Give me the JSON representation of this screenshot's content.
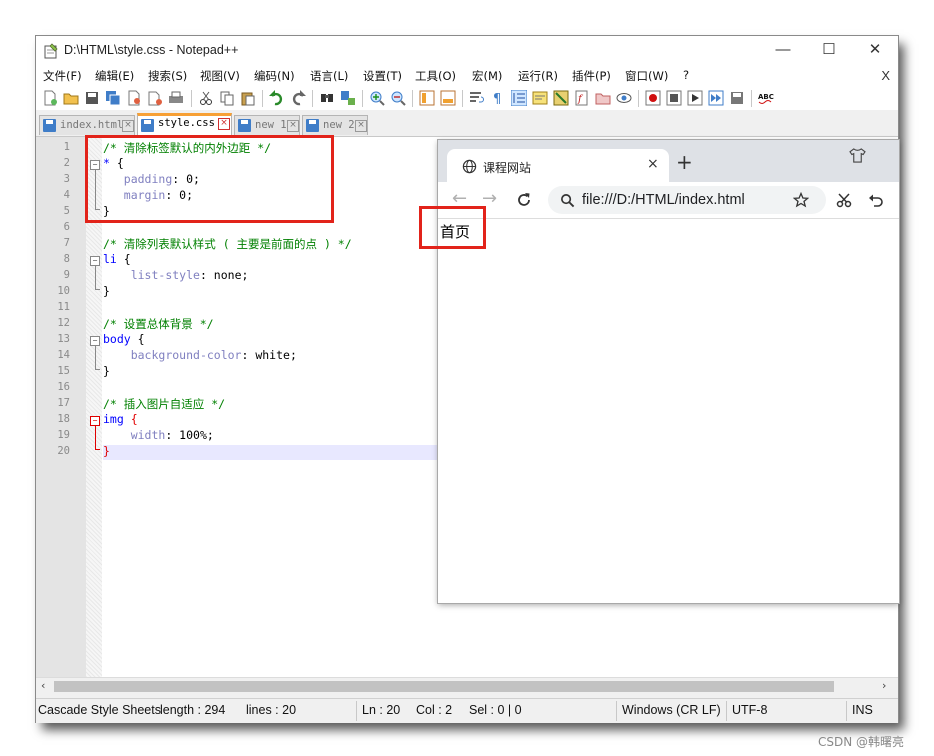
{
  "window": {
    "title": "D:\\HTML\\style.css - Notepad++",
    "minimize": "—",
    "maximize": "☐",
    "close": "✕"
  },
  "menu": {
    "items": [
      "文件(F)",
      "编辑(E)",
      "搜索(S)",
      "视图(V)",
      "编码(N)",
      "语言(L)",
      "设置(T)",
      "工具(O)",
      "宏(M)",
      "运行(R)",
      "插件(P)",
      "窗口(W)",
      "?"
    ],
    "close": "X"
  },
  "tabs": [
    {
      "label": "index.html",
      "active": false
    },
    {
      "label": "style.css",
      "active": true
    },
    {
      "label": "new 1",
      "active": false
    },
    {
      "label": "new 2",
      "active": false
    }
  ],
  "editor": {
    "line_numbers": [
      "1",
      "2",
      "3",
      "4",
      "5",
      "6",
      "7",
      "8",
      "9",
      "10",
      "11",
      "12",
      "13",
      "14",
      "15",
      "16",
      "17",
      "18",
      "19",
      "20"
    ],
    "lines": {
      "l1": "/* 清除标签默认的内外边距 */",
      "l2_sel": "* ",
      "l2_brace": "{",
      "l3_prop": "padding",
      "l3_val": ": 0;",
      "l4_prop": "margin",
      "l4_val": ": 0;",
      "l5": "}",
      "l7": "/* 清除列表默认样式 ( 主要是前面的点 ) */",
      "l8_sel": "li ",
      "l8_brace": "{",
      "l9_prop": "list-style",
      "l9_val": ": none;",
      "l10": "}",
      "l12": "/* 设置总体背景 */",
      "l13_sel": "body ",
      "l13_brace": "{",
      "l14_prop": "background-color",
      "l14_val": ": white;",
      "l15": "}",
      "l17": "/* 插入图片自适应 */",
      "l18_sel": "img ",
      "l18_brace": "{",
      "l19_prop": "width",
      "l19_val": ": 100%;",
      "l20": "}"
    }
  },
  "status": {
    "language": "Cascade Style Sheets",
    "length": "length : 294",
    "lines": "lines : 20",
    "ln": "Ln : 20",
    "col": "Col : 2",
    "sel": "Sel : 0 | 0",
    "eol": "Windows (CR LF)",
    "encoding": "UTF-8",
    "mode": "INS"
  },
  "browser": {
    "tab_title": "课程网站",
    "tab_close": "×",
    "new_tab": "+",
    "url": "file:///D:/HTML/index.html",
    "page_text": "首页",
    "back": "←",
    "forward": "→"
  },
  "watermark": "CSDN @韩曙亮",
  "colors": {
    "annotation_red": "#e2231a",
    "comment_green": "#008000",
    "selector_blue": "#0000ff",
    "property_purple": "#8080c0",
    "active_tab_accent": "#f7a035"
  }
}
